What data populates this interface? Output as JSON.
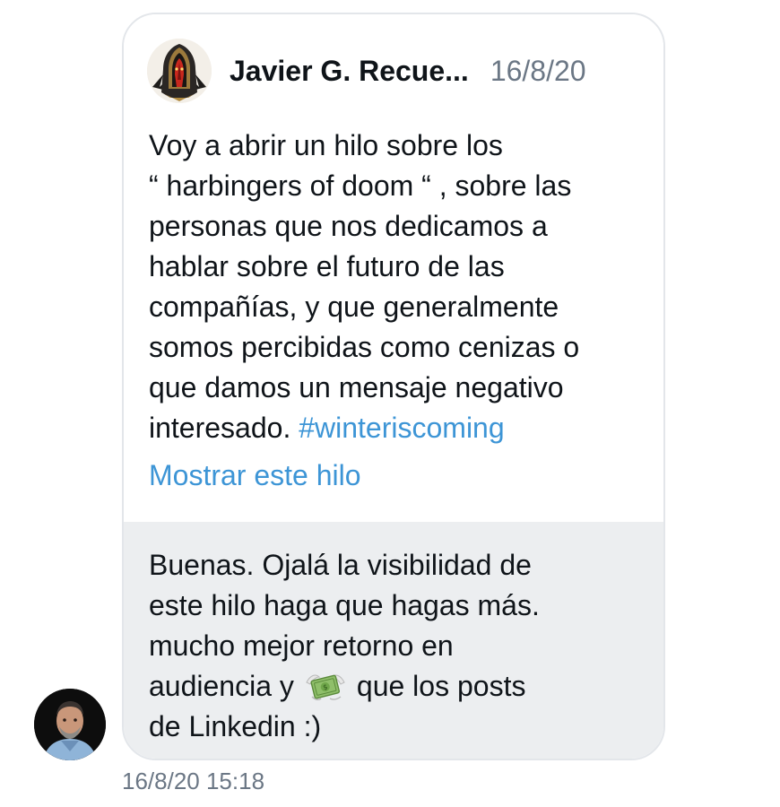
{
  "quoted_tweet": {
    "author_name": "Javier G. Recue...",
    "date": "16/8/20",
    "avatar_icon": "hooded-figure-avatar",
    "text_lines": [
      "Voy a abrir un hilo sobre los",
      "“ harbingers of doom “ , sobre las",
      "personas que nos dedicamos a",
      "hablar sobre el futuro de las",
      "compañías, y que generalmente",
      "somos percibidas como cenizas o",
      "que damos un mensaje negativo",
      "interesado."
    ],
    "hashtag": "#winteriscoming",
    "show_thread_label": "Mostrar este hilo"
  },
  "reply_message": {
    "lines": [
      "Buenas. Ojalá la visibilidad de",
      "este hilo haga que hagas más.",
      "mucho mejor retorno en"
    ],
    "line4_before_emoji": "audiencia y",
    "emoji_icon": "money-with-wings-icon",
    "line4_after_emoji": "que los posts",
    "line5": "de Linkedin :)",
    "sender_avatar_icon": "user-photo-avatar"
  },
  "timestamp": "16/8/20 15:18",
  "colors": {
    "link_blue": "#3d95d6",
    "muted_gray": "#6b7785",
    "reply_background": "#eceef0",
    "bubble_border": "#e3e6ea"
  }
}
